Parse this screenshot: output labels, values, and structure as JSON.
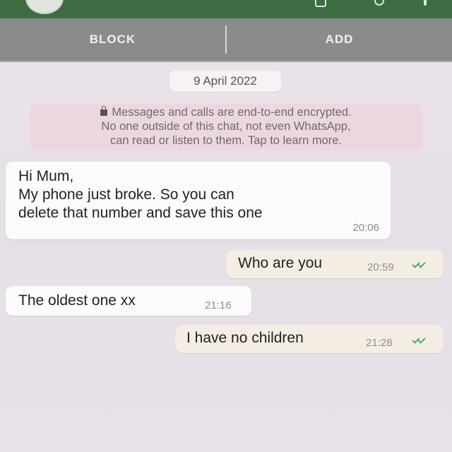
{
  "actions": {
    "block_label": "BLOCK",
    "add_label": "ADD"
  },
  "date_chip": "9 April 2022",
  "encryption_notice": {
    "line1": "Messages and calls are end-to-end encrypted.",
    "line2": "No one outside of this chat, not even WhatsApp,",
    "line3": "can read or listen to them. Tap to learn more.",
    "icon": "lock-icon"
  },
  "messages": [
    {
      "direction": "incoming",
      "lines": [
        "Hi Mum,",
        "My phone just broke. So you can",
        "delete that number and save this one"
      ],
      "time": "20:06"
    },
    {
      "direction": "outgoing",
      "text": "Who are you",
      "time": "20:59",
      "status": "read"
    },
    {
      "direction": "incoming",
      "text": "The oldest one xx",
      "time": "21:16"
    },
    {
      "direction": "outgoing",
      "text": "I have no children",
      "time": "21:28",
      "status": "read"
    }
  ],
  "colors": {
    "appbar": "#3f6b43",
    "actionbar": "#8a8c8b",
    "chat_background": "#e9e2e9",
    "incoming_bubble": "#fcfbfc",
    "outgoing_bubble": "#f3ede4",
    "read_ticks": "#5aa86a"
  }
}
